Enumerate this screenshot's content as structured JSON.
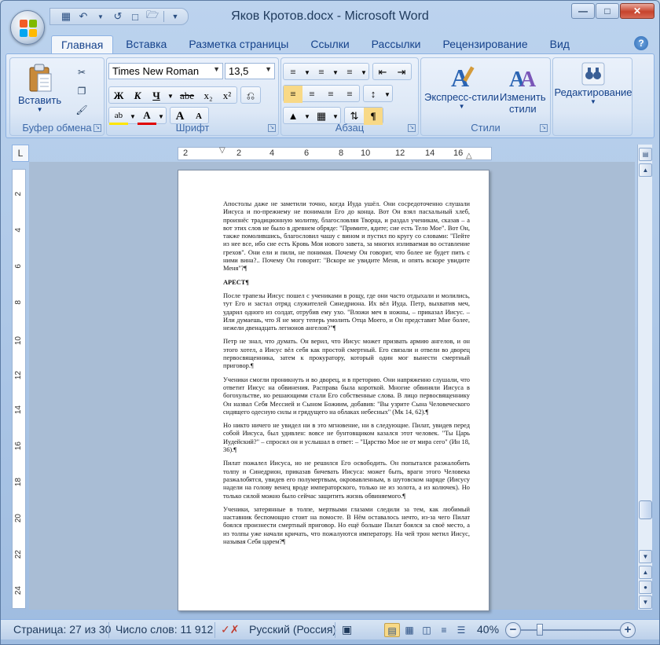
{
  "window": {
    "title": "Яков Кротов.docx - Microsoft Word"
  },
  "tabs": [
    "Главная",
    "Вставка",
    "Разметка страницы",
    "Ссылки",
    "Рассылки",
    "Рецензирование",
    "Вид"
  ],
  "ribbon": {
    "clipboard": {
      "label": "Буфер обмена",
      "paste": "Вставить"
    },
    "font": {
      "label": "Шрифт",
      "font_name": "Times New Roman",
      "font_size": "13,5",
      "bold": "Ж",
      "italic": "К",
      "underline": "Ч",
      "strike": "abe",
      "subscript": "x₂",
      "superscript": "x²",
      "grow": "A",
      "shrink": "A",
      "color": "A"
    },
    "paragraph": {
      "label": "Абзац",
      "pilcrow": "¶"
    },
    "styles": {
      "label": "Стили",
      "quick_styles": "Экспресс-стили",
      "change_styles_1": "Изменить",
      "change_styles_2": "стили"
    },
    "editing": {
      "label": "Редактирование"
    }
  },
  "ruler": {
    "horizontal": [
      "2",
      "2",
      "4",
      "6",
      "8",
      "10",
      "12",
      "14",
      "16"
    ],
    "vertical": [
      "2",
      "4",
      "6",
      "8",
      "10",
      "12",
      "14",
      "16",
      "18",
      "20",
      "22",
      "24"
    ]
  },
  "document": {
    "paragraphs": [
      "Апостолы даже не заметили точно, когда Иуда ушёл. Они сосредоточенно слушали Иисуса и по-прежнему не понимали Его до конца. Вот Он взял пасхальный хлеб, произнёс традиционную молитву, благословляя Творца, и раздал ученикам, сказав – а вот этих слов не было в древнем обряде: \"Примите, ядите; сие есть Тело Мое\". Вот Он, также помолившись, благословил чашу с вином и пустил по кругу со словами: \"Пейте из нее все, ибо сие есть Кровь Моя нового завета, за многих изливаемая во оставление грехов\". Они ели и пили, не понимая. Почему Он говорит, что более не будет пить с ними вина?.. Почему Он говорит: \"Вскоре не увидите Меня, и опять вскоре увидите Меня\"?¶",
      "После трапезы Иисус пошел с учениками в рощу, где они часто отдыхали и молились, тут Его и застал отряд служителей Синедриона. Их вёл Иуда. Петр, выхватив меч, ударил одного из солдат, отрубив ему ухо. \"Вложи меч в ножны, – приказал Иисус. – Или думаешь, что Я не могу теперь умолить Отца Моего, и Он представит Мне более, нежели двенадцать легионов ангелов?\"¶",
      "Петр не знал, что думать. Он верил, что Иисус может призвать армию ангелов, и он этого хотел, а Иисус вёл себя как простой смертный. Его связали и отвели во дворец первосвященника, затем к прокуратору, который один мог вынести смертный приговор.¶",
      "Ученики смогли проникнуть и во дворец, и в преторию. Они напряженно слушали, что ответит Иисус на обвинения. Расправа была короткой. Многие обвиняли Иисуса в богохульстве, но решающими стали Его собственные слова. В лицо первосвященнику Он назвал Себя Мессией и Сыном Божиим, добавив: \"Вы узрите Сына Человеческого сидящего одесную силы и грядущего на облаках небесных\" (Мк 14, 62).¶",
      "Но никто ничего не увидел ни в это мгновение, ни в следующие. Пилат, увидев перед собой Иисуса, был удивлен: вовсе не бунтовщиком казался этот человек. \"Ты Царь Иудейский?\" – спросил он и услышал в ответ: – \"Царство Мое не от мира сего\" (Ин 18, 36).¶",
      "Пилат пожалел Иисуса, но не решился Его освободить. Он попытался разжалобить толпу и Синедрион, приказав бичевать Иисуса: может быть, враги этого Человека разжалобятся, увидев его полумертвым, окровавленным, в шутовском наряде (Иисусу надели на голову венец вроде императорского, только не из золота, а из колючек). Но только силой можно было сейчас защитить жизнь обвиняемого.¶",
      "Ученики, затерянные в толпе, мертвыми глазами следили за тем, как любимый наставник беспомощно стоит на помосте. В Нём оставалось нечто, из-за чего Пилат боялся произнести смертный приговор. Но ещё больше Пилат боялся за своё место, а из толпы уже начали кричать, что пожалуются императору. На чей трон метил Иисус, называя Себя царем?¶"
    ],
    "heading": "АРЕСТ¶"
  },
  "status": {
    "page": "Страница: 27 из 30",
    "words": "Число слов: 11 912",
    "language": "Русский (Россия)",
    "zoom": "40%"
  }
}
